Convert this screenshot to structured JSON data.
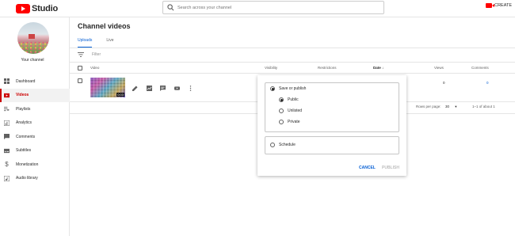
{
  "topbar": {
    "logo_text": "Studio",
    "search_placeholder": "Search across your channel",
    "create_label": "CREATE"
  },
  "sidebar": {
    "channel_label": "Your channel",
    "items": [
      {
        "label": "Dashboard",
        "icon": "dashboard-icon",
        "active": false
      },
      {
        "label": "Videos",
        "icon": "videos-icon",
        "active": true
      },
      {
        "label": "Playlists",
        "icon": "playlists-icon",
        "active": false
      },
      {
        "label": "Analytics",
        "icon": "analytics-icon",
        "active": false
      },
      {
        "label": "Comments",
        "icon": "comments-icon",
        "active": false
      },
      {
        "label": "Subtitles",
        "icon": "subtitles-icon",
        "active": false
      },
      {
        "label": "Monetization",
        "icon": "monetization-icon",
        "active": false
      },
      {
        "label": "Audio library",
        "icon": "audio-library-icon",
        "active": false
      }
    ]
  },
  "main": {
    "title": "Channel videos",
    "tabs": [
      {
        "label": "Uploads",
        "active": true
      },
      {
        "label": "Live",
        "active": false
      }
    ],
    "filter_placeholder": "Filter",
    "columns": {
      "video": "Video",
      "visibility": "Visibility",
      "restrictions": "Restrictions",
      "date": "Date",
      "views": "Views",
      "comments": "Comments"
    },
    "row": {
      "duration": "0:03",
      "views": "0",
      "comments": "0"
    },
    "pager": {
      "rows_per_page_label": "Rows per page:",
      "rows_per_page_value": "30",
      "range": "1–1 of about 1"
    }
  },
  "popup": {
    "save_or_publish": "Save or publish",
    "options": [
      "Public",
      "Unlisted",
      "Private"
    ],
    "selected": "Public",
    "schedule": "Schedule",
    "cancel": "CANCEL",
    "publish": "PUBLISH"
  },
  "colors": {
    "brand_red": "#ff0000",
    "active_red": "#cc0000",
    "link_blue": "#065fd4"
  }
}
